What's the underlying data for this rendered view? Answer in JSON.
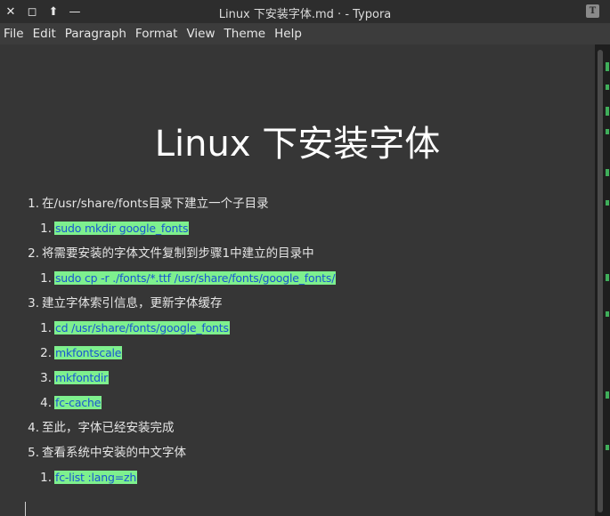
{
  "window": {
    "title": "Linux 下安装字体.md · - Typora",
    "app_icon_letter": "T"
  },
  "window_controls": {
    "close": "✕",
    "maximize": "◻",
    "up": "⬆",
    "minimize": "—"
  },
  "menu": [
    "File",
    "Edit",
    "Paragraph",
    "Format",
    "View",
    "Theme",
    "Help"
  ],
  "document": {
    "heading": "Linux 下安装字体",
    "steps": [
      {
        "number": "1.",
        "text": "在/usr/share/fonts目录下建立一个子目录",
        "sub": [
          {
            "number": "1.",
            "code": "sudo mkdir google_fonts"
          }
        ]
      },
      {
        "number": "2.",
        "text": "将需要安装的字体文件复制到步骤1中建立的目录中",
        "sub": [
          {
            "number": "1.",
            "code": "sudo cp -r ./fonts/*.ttf /usr/share/fonts/google_fonts/"
          }
        ]
      },
      {
        "number": "3.",
        "text": "建立字体索引信息，更新字体缓存",
        "sub": [
          {
            "number": "1.",
            "code": "cd /usr/share/fonts/google_fonts"
          },
          {
            "number": "2.",
            "code": "mkfontscale"
          },
          {
            "number": "3.",
            "code": "mkfontdir"
          },
          {
            "number": "4.",
            "code": "fc-cache"
          }
        ]
      },
      {
        "number": "4.",
        "text": "至此，字体已经安装完成",
        "sub": []
      },
      {
        "number": "5.",
        "text": "查看系统中安装的中文字体",
        "sub": [
          {
            "number": "1.",
            "code": "fc-list :lang=zh"
          }
        ]
      }
    ]
  },
  "colors": {
    "editor_bg": "#363636",
    "code_bg": "#7ef08e",
    "code_fg": "#1a56d0",
    "text": "#e6e6e6"
  }
}
